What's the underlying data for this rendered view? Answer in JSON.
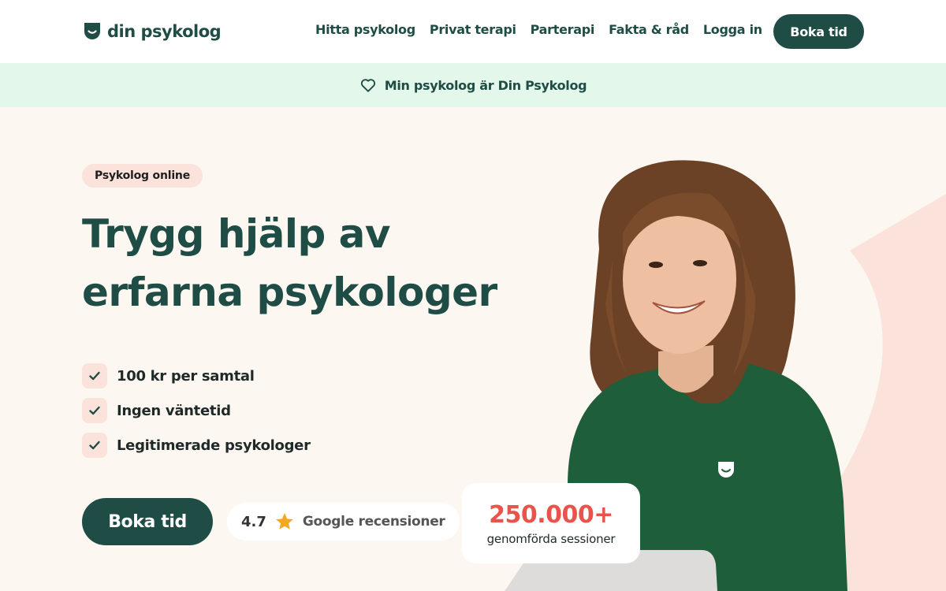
{
  "header": {
    "logo_text": "din psykolog",
    "nav": [
      "Hitta psykolog",
      "Privat terapi",
      "Parterapi",
      "Fakta & råd",
      "Logga in"
    ],
    "cta_label": "Boka tid"
  },
  "banner": {
    "icon": "heart-icon",
    "text": "Min psykolog är Din Psykolog"
  },
  "hero": {
    "badge": "Psykolog online",
    "headline_line1": "Trygg hjälp av",
    "headline_line2": "erfarna psykologer",
    "features": [
      "100 kr per samtal",
      "Ingen väntetid",
      "Legitimerade psykologer"
    ],
    "cta_label": "Boka tid",
    "rating": {
      "score": "4.7",
      "icon": "star-icon",
      "label": "Google recensioner"
    },
    "stats": {
      "value": "250.000+",
      "label": "genomförda sessioner"
    }
  },
  "colors": {
    "brand": "#1f4d45",
    "banner_bg": "#e3f7ea",
    "hero_bg": "#fdf7f2",
    "peach": "#fbe3db",
    "stats_accent": "#e8534a",
    "star": "#f5a623"
  }
}
